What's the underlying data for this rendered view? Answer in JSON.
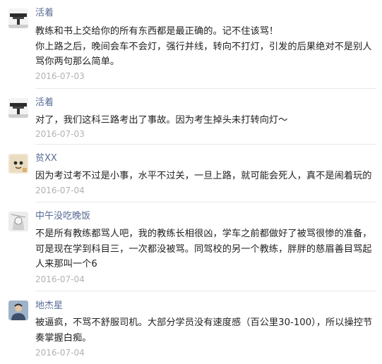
{
  "comments": [
    {
      "avatar_icon": "road-photo-avatar",
      "name": "活着",
      "text": "教练和书上交给你的所有东西都是最正确的。记不住该骂！\n你上路之后，晚间会车不会灯，强行并线，转向不打灯，引发的后果绝对不是别人骂你两句那么简单。",
      "date": "2016-07-03"
    },
    {
      "avatar_icon": "road-photo-avatar",
      "name": "活着",
      "text": "对了，我们这科三路考出了事故。因为考生掉头未打转向灯～",
      "date": "2016-07-03"
    },
    {
      "avatar_icon": "cartoon-face-avatar",
      "name": "贫XX",
      "text": "因为考过考不过是小事，水平不过关，一旦上路，就可能会死人，真不是闹着玩的",
      "date": "2016-07-04"
    },
    {
      "avatar_icon": "sketch-portrait-avatar",
      "name": "中午没吃晚饭",
      "text": "不是所有教练都骂人吧，我的教练长相很凶，学车之前都做好了被骂很惨的准备，可是现在学到科目三，一次都没被骂。同驾校的另一个教练，胖胖的慈眉善目骂起人来那叫一个6",
      "date": "2016-07-04"
    },
    {
      "avatar_icon": "person-photo-avatar",
      "name": "地杰星",
      "text": "被逼疯，不骂不舒服司机。大部分学员没有速度感（百公里30-100），所以操控节奏掌握白痴。",
      "date": "2016-07-04"
    }
  ]
}
